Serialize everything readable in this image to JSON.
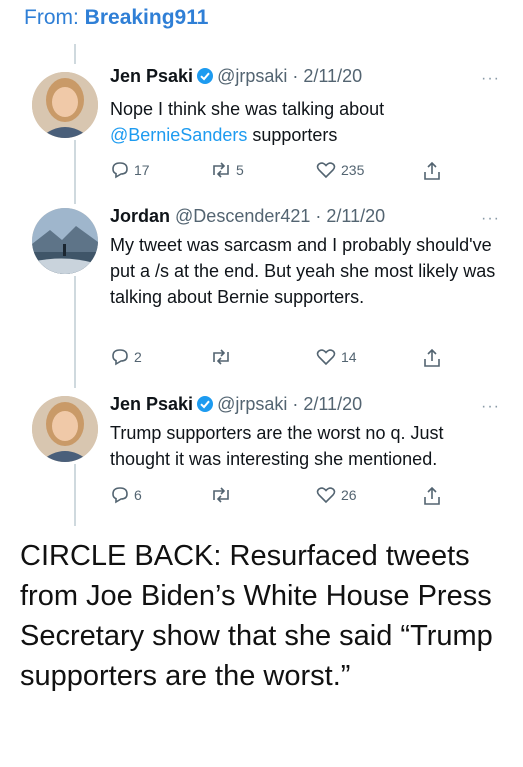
{
  "header": {
    "from_label": "From:",
    "sender": "Breaking911"
  },
  "tweets": [
    {
      "name": "Jen Psaki",
      "handle": "@jrpsaki",
      "date": "· 2/11/20",
      "verified": true,
      "text_parts": [
        "Nope I think she was talking about ",
        "@BernieSanders",
        " supporters"
      ],
      "replies": "17",
      "retweets": "5",
      "likes": "235"
    },
    {
      "name": "Jordan",
      "handle": "@Descender421",
      "date": "· 2/11/20",
      "verified": false,
      "text": "My tweet was sarcasm and I probably should've put a /s at the end.  But yeah she most likely was talking about Bernie supporters.",
      "replies": "2",
      "retweets": "",
      "likes": "14"
    },
    {
      "name": "Jen Psaki",
      "handle": "@jrpsaki",
      "date": "· 2/11/20",
      "verified": true,
      "text": "Trump supporters are the worst no q. Just thought it was interesting she mentioned.",
      "replies": "6",
      "retweets": "",
      "likes": "26"
    }
  ],
  "caption": "CIRCLE BACK: Resurfaced tweets from Joe Biden’s White House Press Secretary show that she said “Trump supporters are the worst.”",
  "colors": {
    "link": "#1d9bf0",
    "header_link": "#2f7fd6",
    "verified": "#1d9bf0"
  },
  "icons": [
    "reply-icon",
    "retweet-icon",
    "like-icon",
    "share-icon",
    "verified-badge-icon",
    "more-options-icon"
  ]
}
